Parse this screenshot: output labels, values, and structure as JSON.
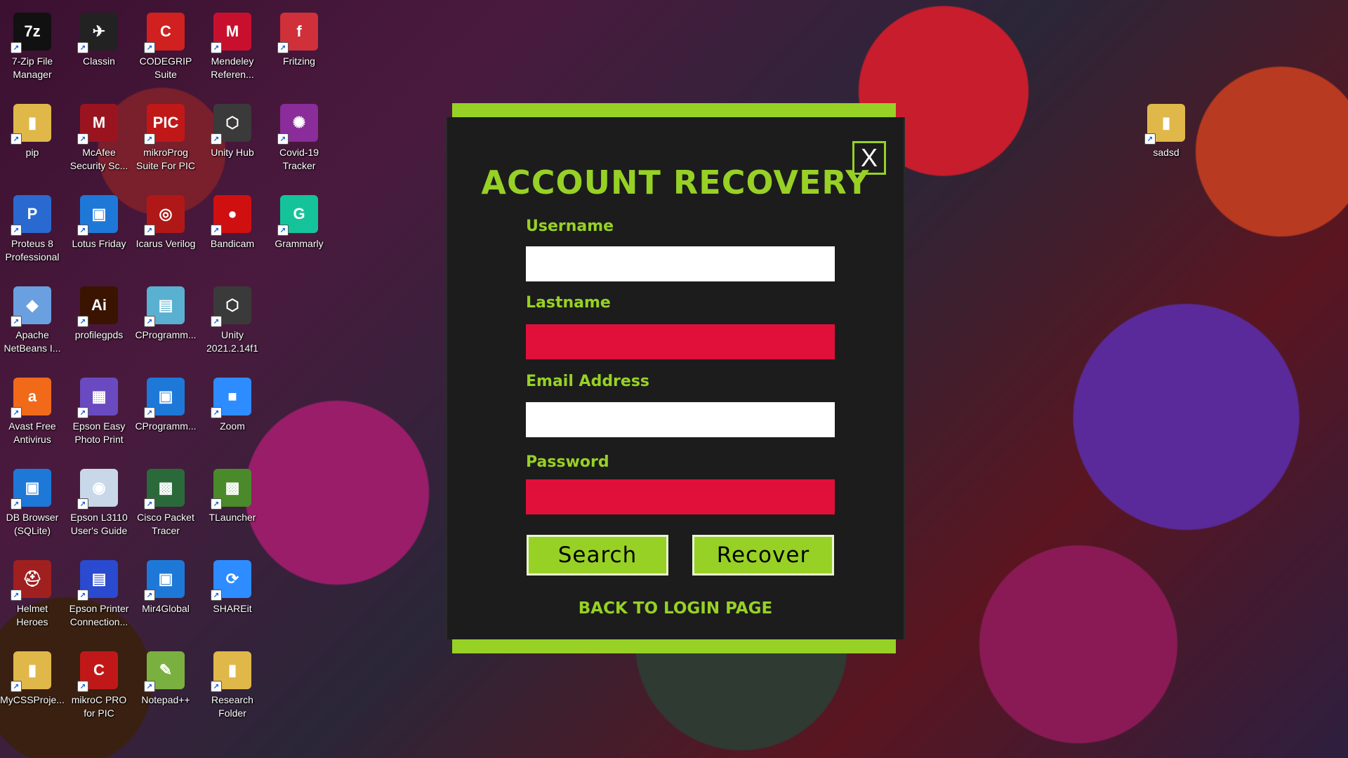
{
  "desktop": {
    "icons": [
      {
        "label": "7-Zip File Manager",
        "glyph": "7z",
        "color": "#111111"
      },
      {
        "label": "Classin",
        "glyph": "✈",
        "color": "#222222"
      },
      {
        "label": "CODEGRIP Suite",
        "glyph": "C",
        "color": "#d02020"
      },
      {
        "label": "Mendeley Referen...",
        "glyph": "M",
        "color": "#c8102e"
      },
      {
        "label": "Fritzing",
        "glyph": "f",
        "color": "#d0303a"
      },
      {
        "label": "pip",
        "glyph": "▮",
        "color": "#e0b84a"
      },
      {
        "label": "McAfee Security Sc...",
        "glyph": "M",
        "color": "#9a1420"
      },
      {
        "label": "mikroProg Suite For PIC",
        "glyph": "PIC",
        "color": "#c01818"
      },
      {
        "label": "Unity Hub",
        "glyph": "⬡",
        "color": "#3a3a3a"
      },
      {
        "label": "Covid-19 Tracker",
        "glyph": "✺",
        "color": "#8a2c9a"
      },
      {
        "label": "Proteus 8 Professional",
        "glyph": "P",
        "color": "#2a6ad0"
      },
      {
        "label": "Lotus Friday",
        "glyph": "▣",
        "color": "#1e78d8"
      },
      {
        "label": "Icarus Verilog",
        "glyph": "◎",
        "color": "#b01818"
      },
      {
        "label": "Bandicam",
        "glyph": "●",
        "color": "#d01010"
      },
      {
        "label": "Grammarly",
        "glyph": "G",
        "color": "#15c39a"
      },
      {
        "label": "Apache NetBeans I...",
        "glyph": "◆",
        "color": "#6aa0e0"
      },
      {
        "label": "profilegpds",
        "glyph": "Ai",
        "color": "#3a1400"
      },
      {
        "label": "CProgramm...",
        "glyph": "▤",
        "color": "#5ab0d0"
      },
      {
        "label": "Unity 2021.2.14f1",
        "glyph": "⬡",
        "color": "#3a3a3a"
      },
      {
        "label": "Avast Free Antivirus",
        "glyph": "a",
        "color": "#f06a1a"
      },
      {
        "label": "Epson Easy Photo Print",
        "glyph": "▦",
        "color": "#6a4ac0"
      },
      {
        "label": "CProgramm...",
        "glyph": "▣",
        "color": "#1e78d8"
      },
      {
        "label": "Zoom",
        "glyph": "■",
        "color": "#2d8cff"
      },
      {
        "label": "DB Browser (SQLite)",
        "glyph": "▣",
        "color": "#1e78d8"
      },
      {
        "label": "Epson L3110 User's Guide",
        "glyph": "◉",
        "color": "#c8d8e8"
      },
      {
        "label": "Cisco Packet Tracer",
        "glyph": "▩",
        "color": "#2a6a3a"
      },
      {
        "label": "TLauncher",
        "glyph": "▩",
        "color": "#4a8a2a"
      },
      {
        "label": "Helmet Heroes",
        "glyph": "⛑",
        "color": "#a02020"
      },
      {
        "label": "Epson Printer Connection...",
        "glyph": "▤",
        "color": "#2a4ad0"
      },
      {
        "label": "Mir4Global",
        "glyph": "▣",
        "color": "#1e78d8"
      },
      {
        "label": "SHAREit",
        "glyph": "⟳",
        "color": "#2d8cff"
      },
      {
        "label": "MyCSSProje...",
        "glyph": "▮",
        "color": "#e0b84a"
      },
      {
        "label": "mikroC PRO for PIC",
        "glyph": "C",
        "color": "#c01818"
      },
      {
        "label": "Notepad++",
        "glyph": "✎",
        "color": "#7ab040"
      },
      {
        "label": "Research Folder",
        "glyph": "▮",
        "color": "#e0b84a"
      },
      {
        "label": "sadsd",
        "glyph": "▮",
        "color": "#e0b84a"
      }
    ]
  },
  "dialog": {
    "close_label": "X",
    "title": "ACCOUNT RECOVERY",
    "username_label": "Username",
    "lastname_label": "Lastname",
    "email_label": "Email Address",
    "password_label": "Password",
    "username_value": "",
    "lastname_value": "",
    "email_value": "",
    "password_value": "",
    "search_label": "Search",
    "recover_label": "Recover",
    "back_link": "BACK TO LOGIN PAGE"
  },
  "colors": {
    "accent": "#97d125",
    "panel": "#1c1c1c",
    "error_field": "#e0103a"
  }
}
